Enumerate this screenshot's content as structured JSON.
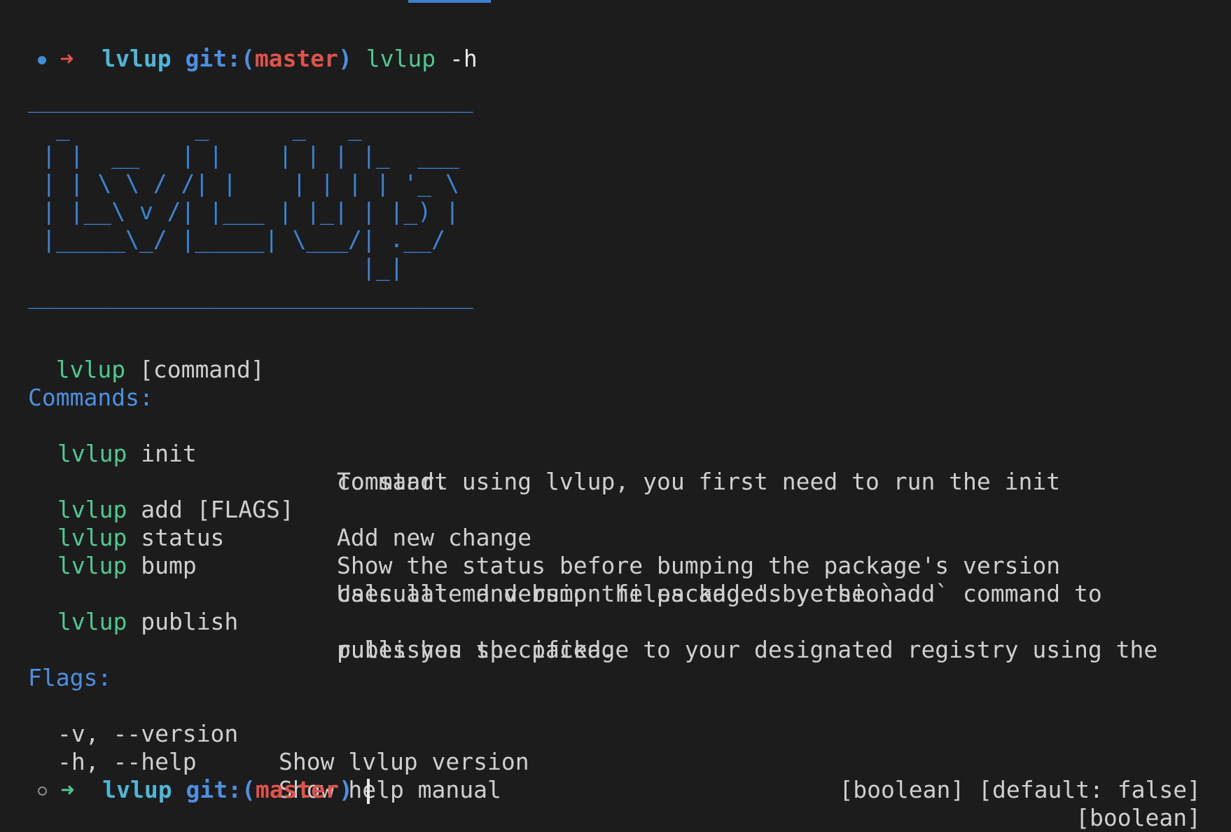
{
  "prompt1": {
    "arrow": "➜",
    "dir": "lvlup",
    "git_label": "git:",
    "paren_open": "(",
    "branch": "master",
    "paren_close": ")",
    "command": "lvlup",
    "args": "-h"
  },
  "banner": {
    "ascii": "________________________________\n  _         _      _   _\n | |  __   | |    | | | |_  ___\n | | \\ \\ / /| |    | | | | '_ \\\n | |__\\ v /| |___ | |_| | |_) |\n |_____\\_/ |_____| \\___/| .__/\n                        |_|\n________________________________"
  },
  "usage": {
    "prog": "lvlup",
    "arg": "[command]"
  },
  "commands_header": "Commands:",
  "commands": [
    {
      "prog": "lvlup",
      "name": "init",
      "desc1": "To start using lvlup, you first need to run the init",
      "desc2": "command."
    },
    {
      "prog": "lvlup",
      "name": "add [FLAGS]",
      "desc1": "Add new change",
      "desc2": ""
    },
    {
      "prog": "lvlup",
      "name": "status",
      "desc1": "Show the status before bumping the package's version",
      "desc2": ""
    },
    {
      "prog": "lvlup",
      "name": "bump",
      "desc1": "Uses all md version files added by the `add` command to",
      "desc2": "calculate and bump the package's version"
    },
    {
      "prog": "lvlup",
      "name": "publish",
      "desc1": "publishes the package to your designated registry using the",
      "desc2": "rules you specified."
    }
  ],
  "flags_header": "Flags:",
  "flags": [
    {
      "name": "-v, --version",
      "desc": "Show lvlup version",
      "meta": "[boolean] [default: false]"
    },
    {
      "name": "-h, --help",
      "desc": "Show help manual",
      "meta": "[boolean]"
    }
  ],
  "prompt2": {
    "arrow": "➜",
    "dir": "lvlup",
    "git_label": "git:",
    "paren_open": "(",
    "branch": "master",
    "paren_close": ")"
  },
  "colors": {
    "background": "#1c1c1c",
    "green": "#4ec98f",
    "blue": "#4d8fe0",
    "red": "#e0534d",
    "cyan": "#4fb6d8"
  }
}
